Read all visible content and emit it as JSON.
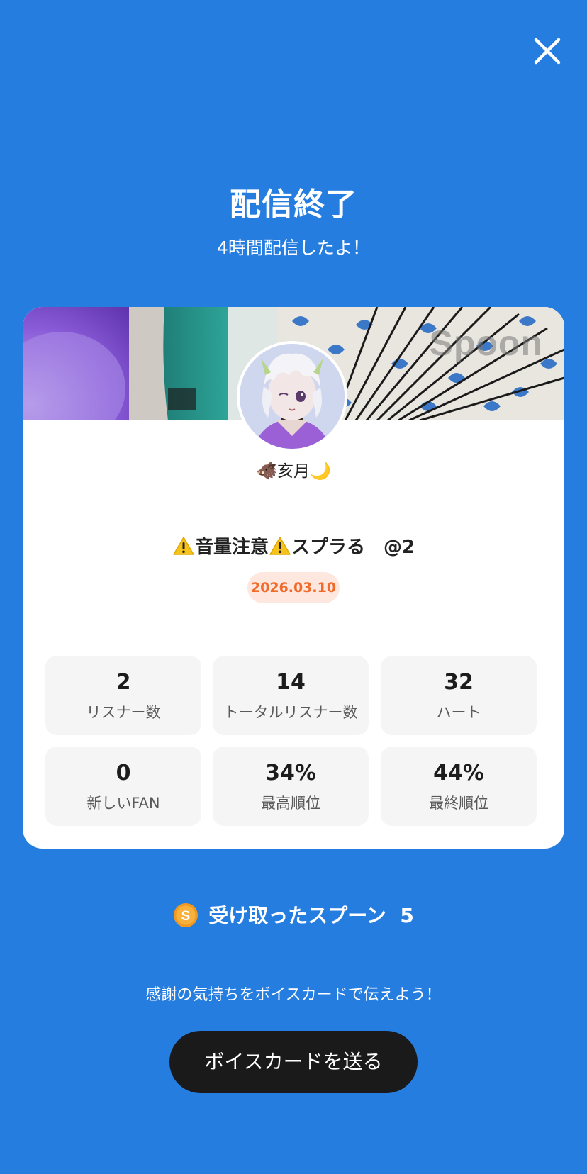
{
  "header": {
    "title": "配信終了",
    "subtitle": "4時間配信したよ！"
  },
  "banner": {
    "watermark": "Spoon"
  },
  "profile": {
    "emoji_left": "🐗",
    "name": "亥月",
    "emoji_right": "🌙"
  },
  "cast": {
    "title_part1": "音量注意",
    "title_part2": "スプラる　@2",
    "date": "2026.03.10"
  },
  "stats": [
    {
      "value": "2",
      "label": "リスナー数"
    },
    {
      "value": "14",
      "label": "トータルリスナー数"
    },
    {
      "value": "32",
      "label": "ハート"
    },
    {
      "value": "0",
      "label": "新しいFAN"
    },
    {
      "value": "34%",
      "label": "最高順位"
    },
    {
      "value": "44%",
      "label": "最終順位"
    }
  ],
  "spoons": {
    "label": "受け取ったスプーン",
    "count": "5"
  },
  "footer": {
    "message": "感謝の気持ちをボイスカードで伝えよう！",
    "button_label": "ボイスカードを送る"
  },
  "colors": {
    "background": "#267de0",
    "date_badge_text": "#f06a2a",
    "coin": "#f39a1e"
  }
}
